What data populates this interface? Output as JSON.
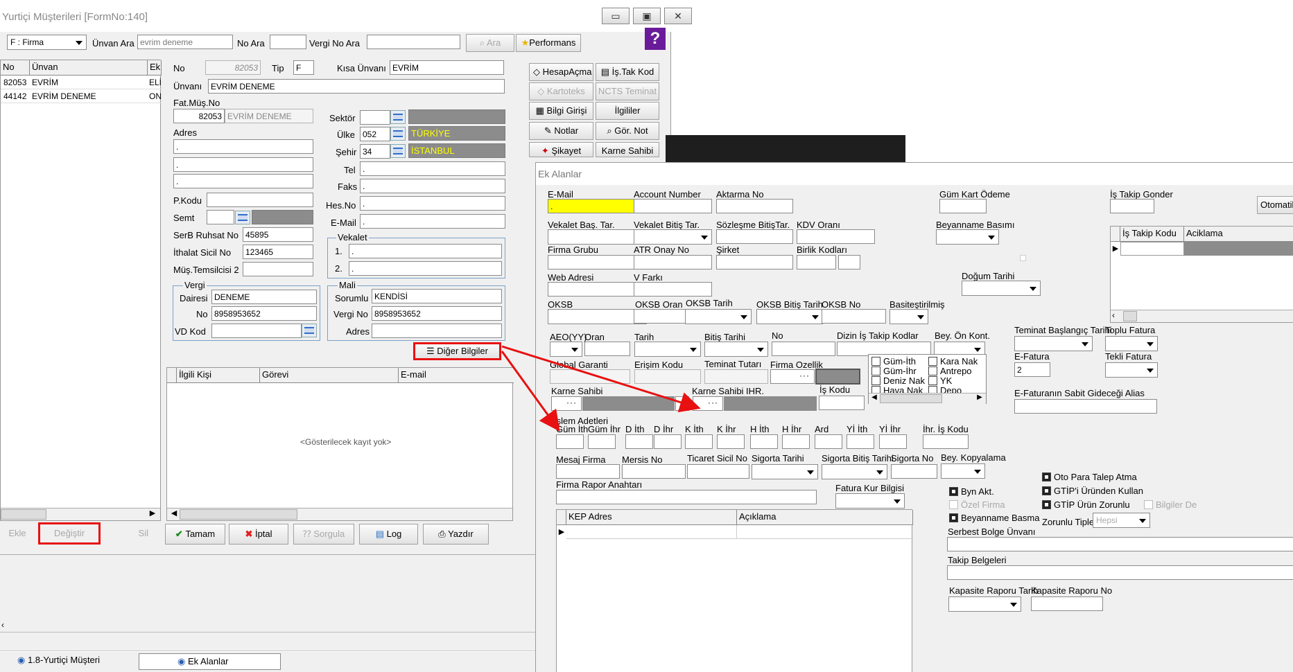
{
  "win1": {
    "title": "Yurtiçi Müşterileri [FormNo:140]",
    "min": "▭",
    "max": "▣",
    "close": "✕"
  },
  "toolbar": {
    "filter": "F : Firma",
    "unvan_label": "Ünvan Ara",
    "unvan_value": "evrim deneme",
    "no_label": "No Ara",
    "vergi_label": "Vergi No Ara",
    "ara": "Ara",
    "perf": "Performans",
    "help": "?"
  },
  "list": {
    "cols": [
      "No",
      "Ünvan",
      "Ek"
    ],
    "rows": [
      [
        "82053",
        "EVRİM",
        "ELİ"
      ],
      [
        "44142",
        "EVRİM DENEME",
        "ON"
      ]
    ]
  },
  "form": {
    "no_label": "No",
    "no": "82053",
    "tip_label": "Tip",
    "tip": "F",
    "kisa_label": "Kısa Ünvanı",
    "kisa": "EVRİM",
    "unvan_label": "Ünvanı",
    "unvan": "EVRİM DENEME",
    "fatmus_label": "Fat.Müş.No",
    "fatmus_no": "82053",
    "fatmus_name": "EVRİM DENEME",
    "adres_label": "Adres",
    "adres1": ".",
    "adres2": ".",
    "adres3": ".",
    "pkodu_label": "P.Kodu",
    "semt_label": "Semt",
    "serb_label": "SerB Ruhsat No",
    "serb": "45895",
    "ithalat_label": "İthalat Sicil No",
    "ithalat": "123465",
    "mustem_label": "Müş.Temsilcisi 2",
    "sektor_label": "Sektör",
    "ulke_label": "Ülke",
    "ulke_code": "052",
    "ulke_name": "TÜRKİYE",
    "sehir_label": "Şehir",
    "sehir_code": "34",
    "sehir_name": "İSTANBUL",
    "tel_label": "Tel",
    "faks_label": "Faks",
    "hesno_label": "Hes.No",
    "email_label": "E-Mail",
    "tel": ".",
    "faks": ".",
    "hesno": ".",
    "email": ".",
    "vekalet_label": "Vekalet",
    "vek1_label": "1.",
    "vek2_label": "2.",
    "vek1": ".",
    "vek2": ".",
    "vergi_grp": "Vergi",
    "vd_label": "Dairesi",
    "vd": "DENEME",
    "vno_label": "No",
    "vno": "8958953652",
    "vdkod_label": "VD Kod",
    "mali_grp": "Mali",
    "sorumlu_label": "Sorumlu",
    "sorumlu": "KENDİSİ",
    "mvergi_label": "Vergi No",
    "mvergi": "8958953652",
    "madres_label": "Adres",
    "diger_btn": "Diğer Bilgiler"
  },
  "side": {
    "hesap": "HesapAçma",
    "istak": "İş.Tak Kod",
    "karto": "Kartoteks",
    "ncts": "NCTS Teminat",
    "bilgi": "Bilgi Girişi",
    "ilgili": "İlgililer",
    "notlar": "Notlar",
    "gor": "Gör. Not",
    "sikayet": "Şikayet",
    "karne": "Karne Sahibi"
  },
  "contacts": {
    "cols": [
      "İlgili Kişi",
      "Görevi",
      "E-mail"
    ],
    "empty": "<Gösterilecek kayıt yok>"
  },
  "actions": {
    "ekle": "Ekle",
    "degistir": "Değiştir",
    "sil": "Sil",
    "tamam": "Tamam",
    "iptal": "İptal",
    "sorgula": "Sorgula",
    "log": "Log",
    "yazdir": "Yazdır"
  },
  "taskbar": {
    "t1": "1.8-Yurtiçi Müşteri",
    "t2": "Ek Alanlar"
  },
  "win2": {
    "title": "Ek Alanlar"
  },
  "ek": {
    "email": "E-Mail",
    "email_val": ".",
    "account": "Account Number",
    "aktarma": "Aktarma No",
    "gumkart": "Güm Kart Ödeme",
    "istakip": "İş Takip Gonder",
    "otomatik": "Otomatik Doldur",
    "vekbas": "Vekalet Baş. Tar.",
    "vekbit": "Vekalet Bitiş Tar.",
    "sozbit": "Sözleşme BitişTar.",
    "kdv": "KDV Oranı",
    "beyanname": "Beyanname Basımı",
    "firmagrubu": "Firma Grubu",
    "atr": "ATR Onay No",
    "sirket": "Şirket",
    "birlik": "Birlik Kodları",
    "istakip_cols": [
      "İş Takip Kodu",
      "Aciklama"
    ],
    "web": "Web Adresi",
    "vfarki": "V Farkı",
    "dogum": "Doğum Tarihi",
    "oksb": "OKSB",
    "oksboran": "OKSB Oran",
    "oksbtarih": "OKSB Tarih",
    "oksbbitis": "OKSB Bitiş Tarih",
    "oksbno": "OKSB No",
    "basitestirilmis": "Basiteştirilmiş",
    "teminatbas": "Teminat Başlangıç Tarihi",
    "toplu": "Toplu Fatura",
    "aeo": "AEO(YY)",
    "oran": "Oran",
    "tarih": "Tarih",
    "bitis": "Bitiş Tarihi",
    "no": "No",
    "dizin": "Dizin İş Takip Kodlar",
    "beyon": "Bey. Ön Kont.",
    "efatura": "E-Fatura",
    "efatura_val": "2",
    "tekli": "Tekli Fatura",
    "global": "Global Garanti",
    "erisim": "Erişim Kodu",
    "teminat": "Teminat Tutarı",
    "firmaoz": "Firma Ozellik",
    "karne": "Karne Sahibi",
    "karneihr": "Karne Sahibi IHR.",
    "iskodu": "İş Kodu",
    "efatalias": "E-Faturanın Sabit Gideceği Alias",
    "chk": [
      "Güm-İth",
      "Güm-İhr",
      "Deniz Nak",
      "Hava Nak",
      "Kara Nak",
      "Antrepo",
      "YK",
      "Depo"
    ],
    "islem": "İşlem Adetleri",
    "islem_cols": [
      "Güm İth",
      "Güm İhr",
      "D İth",
      "D İhr",
      "K İth",
      "K İhr",
      "H İth",
      "H İhr",
      "Ard",
      "Yİ İth",
      "Yİ İhr"
    ],
    "ihris": "İhr. İş Kodu",
    "mesaj": "Mesaj Firma",
    "mersis": "Mersis No",
    "ticaret": "Ticaret Sicil No",
    "sigorta": "Sigorta Tarihi",
    "sigbitis": "Sigorta Bitiş Tarihi",
    "signo": "Sigorta No",
    "beykop": "Bey. Kopyalama",
    "rapor": "Firma Rapor Anahtarı",
    "faturakur": "Fatura Kur Bilgisi",
    "kep_cols": [
      "KEP Adres",
      "Açıklama"
    ],
    "byn": "Byn Akt.",
    "ozel": "Özel Firma",
    "beyb": "Beyanname Basma",
    "otopara": "Oto Para Talep Atma",
    "gtipurun": "GTİP'i Üründen Kullan",
    "gtipzor": "GTİP Ürün Zorunlu",
    "bilgiler": "Bilgiler De",
    "zorunlu": "Zorunlu Tipler",
    "zorunlu_val": "Hepsi",
    "serbest": "Serbest Bolge Ünvanı",
    "takip": "Takip Belgeleri",
    "kaptarih": "Kapasite Raporu Tarih",
    "kapno": "Kapasite Raporu No"
  },
  "colors": {
    "accent_red": "#e81010",
    "yellow": "#ffff00",
    "grey": "#8c8c8c"
  }
}
